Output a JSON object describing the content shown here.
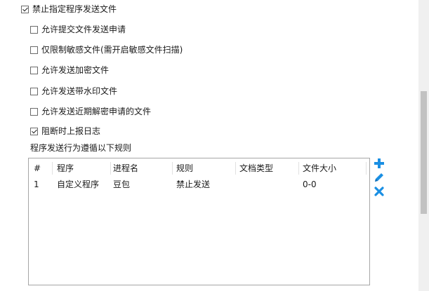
{
  "options": [
    {
      "label": "禁止指定程序发送文件",
      "checked": true
    },
    {
      "label": "允许提交文件发送申请",
      "checked": false
    },
    {
      "label": "仅限制敏感文件(需开启敏感文件扫描)",
      "checked": false
    },
    {
      "label": "允许发送加密文件",
      "checked": false
    },
    {
      "label": "允许发送带水印文件",
      "checked": false
    },
    {
      "label": "允许发送近期解密申请的文件",
      "checked": false
    },
    {
      "label": "阻断时上报日志",
      "checked": true
    }
  ],
  "rules_section_label": "程序发送行为遵循以下规则",
  "table": {
    "columns": [
      "#",
      "程序",
      "进程名",
      "规则",
      "文档类型",
      "文件大小"
    ],
    "rows": [
      [
        "1",
        "自定义程序",
        "豆包",
        "禁止发送",
        "",
        "0-0"
      ]
    ]
  },
  "actions": {
    "add_icon": "plus-icon",
    "edit_icon": "pencil-icon",
    "delete_icon": "x-icon",
    "color": "#1a8fe3"
  }
}
